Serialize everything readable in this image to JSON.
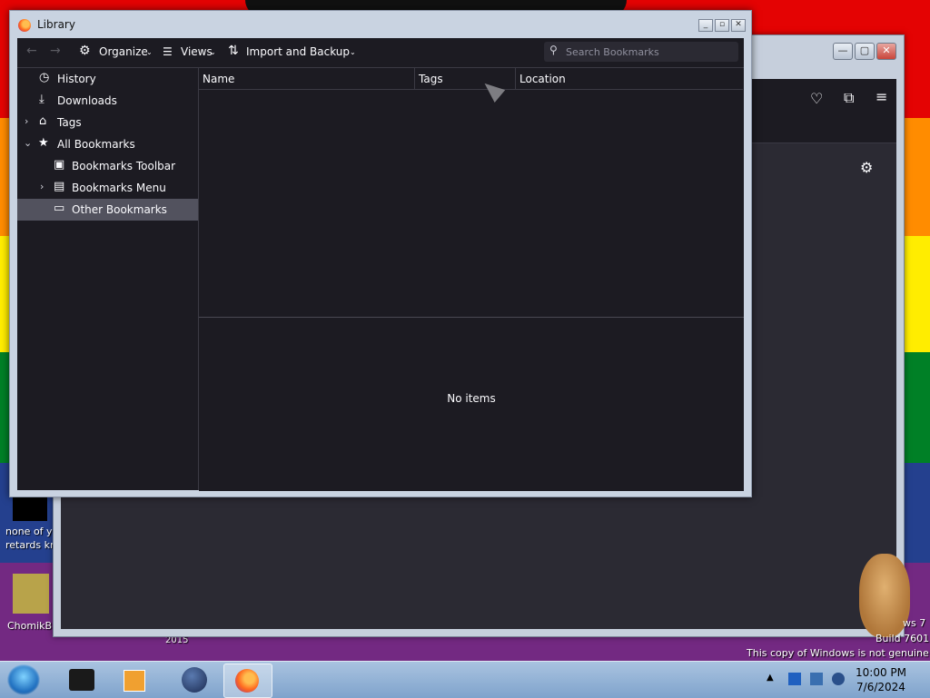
{
  "library": {
    "title": "Library",
    "toolbar": {
      "organize": "Organize",
      "views": "Views",
      "import_backup": "Import and Backup",
      "search_placeholder": "Search Bookmarks"
    },
    "tree": [
      {
        "label": "History",
        "icon": "clock-icon"
      },
      {
        "label": "Downloads",
        "icon": "download-icon"
      },
      {
        "label": "Tags",
        "icon": "tag-icon"
      },
      {
        "label": "All Bookmarks",
        "icon": "star-icon"
      },
      {
        "label": "Bookmarks Toolbar",
        "icon": "bookmarks-toolbar-icon"
      },
      {
        "label": "Bookmarks Menu",
        "icon": "bookmarks-menu-icon"
      },
      {
        "label": "Other Bookmarks",
        "icon": "folder-icon"
      }
    ],
    "columns": [
      "Name",
      "Tags",
      "Location"
    ],
    "empty_message": "No items"
  },
  "desktop": {
    "icon1_label_line1": "none of y",
    "icon1_label_line2": "retards kn",
    "icon2_label": "ChomikB",
    "wallpaper_year": "2015",
    "watermark_line1": "ws 7",
    "watermark_line2": "Build 7601",
    "watermark_line3": "This copy of Windows is not genuine"
  },
  "taskbar": {
    "time": "10:00 PM",
    "date": "7/6/2024"
  },
  "colors": {
    "dark_bg": "#1c1b22",
    "selected_row": "#52525e",
    "text": "#fbfbfe"
  }
}
